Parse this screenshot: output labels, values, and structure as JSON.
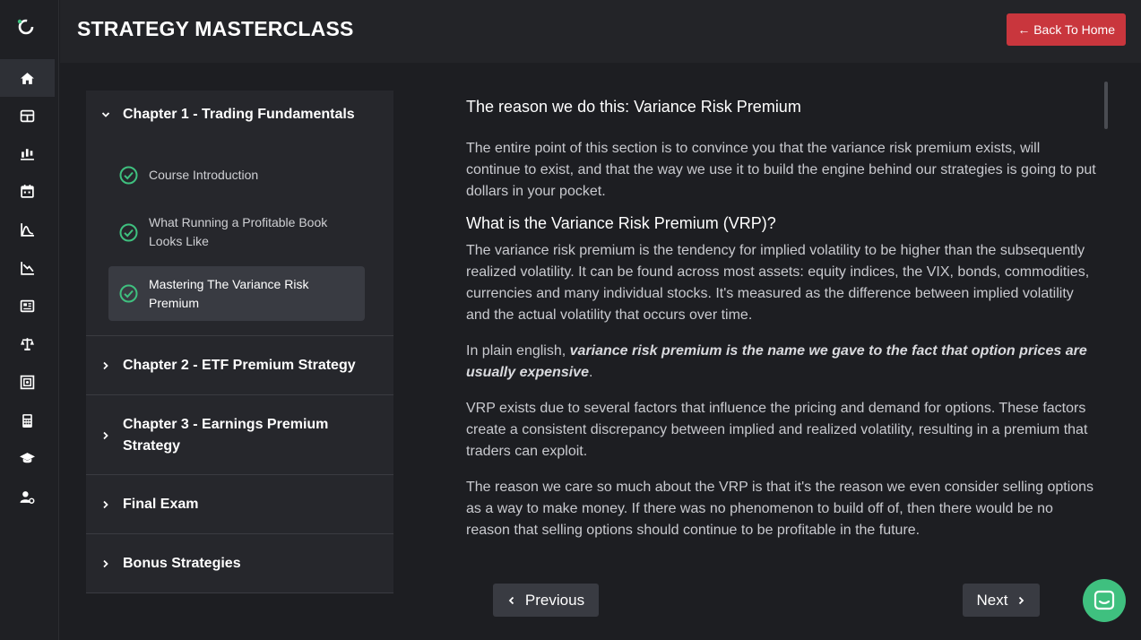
{
  "header": {
    "title": "STRATEGY MASTERCLASS",
    "back_button": "← Back To Home"
  },
  "sidebar": {
    "items": [
      {
        "icon": "home-icon",
        "active": true
      },
      {
        "icon": "dashboard-grid-icon"
      },
      {
        "icon": "trade-chart-icon"
      },
      {
        "icon": "calendar-icon"
      },
      {
        "icon": "volatility-icon"
      },
      {
        "icon": "chart-down-icon"
      },
      {
        "icon": "newspaper-icon"
      },
      {
        "icon": "scale-icon"
      },
      {
        "icon": "portfolio-icon"
      },
      {
        "icon": "calculator-icon"
      },
      {
        "icon": "graduation-cap-icon"
      },
      {
        "icon": "user-settings-icon"
      }
    ]
  },
  "chapters": [
    {
      "title": "Chapter 1 - Trading Fundamentals",
      "expanded": true,
      "lessons": [
        {
          "title": "Course Introduction",
          "completed": true
        },
        {
          "title": "What Running a Profitable Book Looks Like",
          "completed": true
        },
        {
          "title": "Mastering The Variance Risk Premium",
          "completed": true,
          "active": true
        }
      ]
    },
    {
      "title": "Chapter 2 - ETF Premium Strategy",
      "expanded": false
    },
    {
      "title": "Chapter 3 - Earnings Premium Strategy",
      "expanded": false
    },
    {
      "title": "Final Exam",
      "expanded": false
    },
    {
      "title": "Bonus Strategies",
      "expanded": false
    }
  ],
  "content": {
    "heading1": "The reason we do this: Variance Risk Premium",
    "para1": "The entire point of this section is to convince you that the variance risk premium exists, will continue to exist, and that the way we use it to build the engine behind our strategies is going to put dollars in your pocket.",
    "heading2": "What is the Variance Risk Premium (VRP)?",
    "para2": "The variance risk premium is the tendency for implied volatility to be higher than the subsequently realized volatility. It can be found across most assets: equity indices, the VIX, bonds, commodities, currencies and many individual stocks. It's measured as the difference between implied volatility and the actual volatility that occurs over time.",
    "para3_prefix": "In plain english, ",
    "para3_emphasis": "variance risk premium is the name we gave to the fact that option prices are usually expensive",
    "para3_suffix": ".",
    "para4": "VRP exists due to several factors that influence the pricing and demand for options. These factors create a consistent discrepancy between implied and realized volatility, resulting in a premium that traders can exploit.",
    "para5": "The reason we care so much about the VRP is that it's the reason we even consider selling options as a way to make money. If there was no phenomenon to build off of, then there would be no reason that selling options should continue to be profitable in the future."
  },
  "pagination": {
    "previous": "Previous",
    "next": "Next"
  },
  "colors": {
    "accent_green": "#3fc07f",
    "danger_red": "#c9363d",
    "check_green": "#3fc07f"
  }
}
